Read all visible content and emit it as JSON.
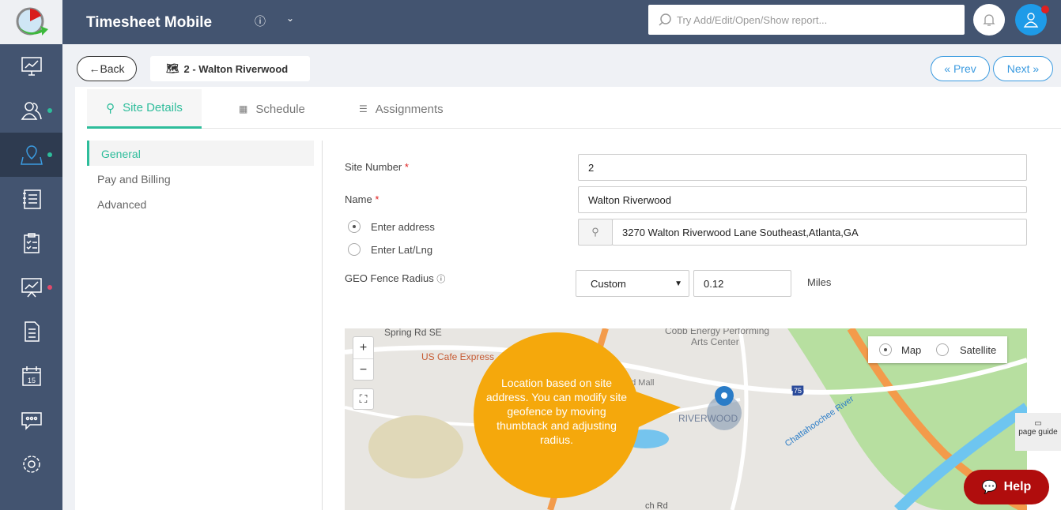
{
  "app": {
    "title": "Timesheet Mobile"
  },
  "header": {
    "search_placeholder": "Try Add/Edit/Open/Show report...",
    "notification_color": "#e02020"
  },
  "page": {
    "back_label": "Back",
    "record_title": "2 - Walton Riverwood",
    "prev_label": "Prev",
    "next_label": "Next"
  },
  "tabs": [
    {
      "label": "Site Details",
      "active": true
    },
    {
      "label": "Schedule"
    },
    {
      "label": "Assignments"
    }
  ],
  "subnav": [
    {
      "label": "General",
      "active": true
    },
    {
      "label": "Pay and Billing"
    },
    {
      "label": "Advanced"
    }
  ],
  "form": {
    "site_number_label": "Site Number",
    "site_number": "2",
    "name_label": "Name",
    "name": "Walton Riverwood",
    "required_mark": "*",
    "enter_address": "Enter address",
    "enter_latlng": "Enter Lat/Lng",
    "address": "3270 Walton Riverwood Lane Southeast,Atlanta,GA",
    "geofence_label": "GEO Fence Radius",
    "geofence_mode": "Custom",
    "geofence_value": "0.12",
    "geofence_unit": "Miles"
  },
  "map": {
    "type_map": "Map",
    "type_satellite": "Satellite",
    "zoom_in": "+",
    "zoom_out": "−",
    "labels": [
      "Spring Rd SE",
      "US Cafe Express",
      "Cobb Energy Performing",
      "Arts Center",
      "nd Mall",
      "RIVERWOOD",
      "Chattahoochee River",
      "75",
      "ch Rd"
    ],
    "callout": "Location based on site address. You can modify site geofence by moving thumbtack and adjusting  radius."
  },
  "page_guide": "page guide",
  "help_label": "Help",
  "colors": {
    "accent": "#2ebd9b",
    "sidebar": "#435470",
    "callout": "#f5a80c",
    "help": "#b00d0d",
    "link": "#3b9be0"
  }
}
